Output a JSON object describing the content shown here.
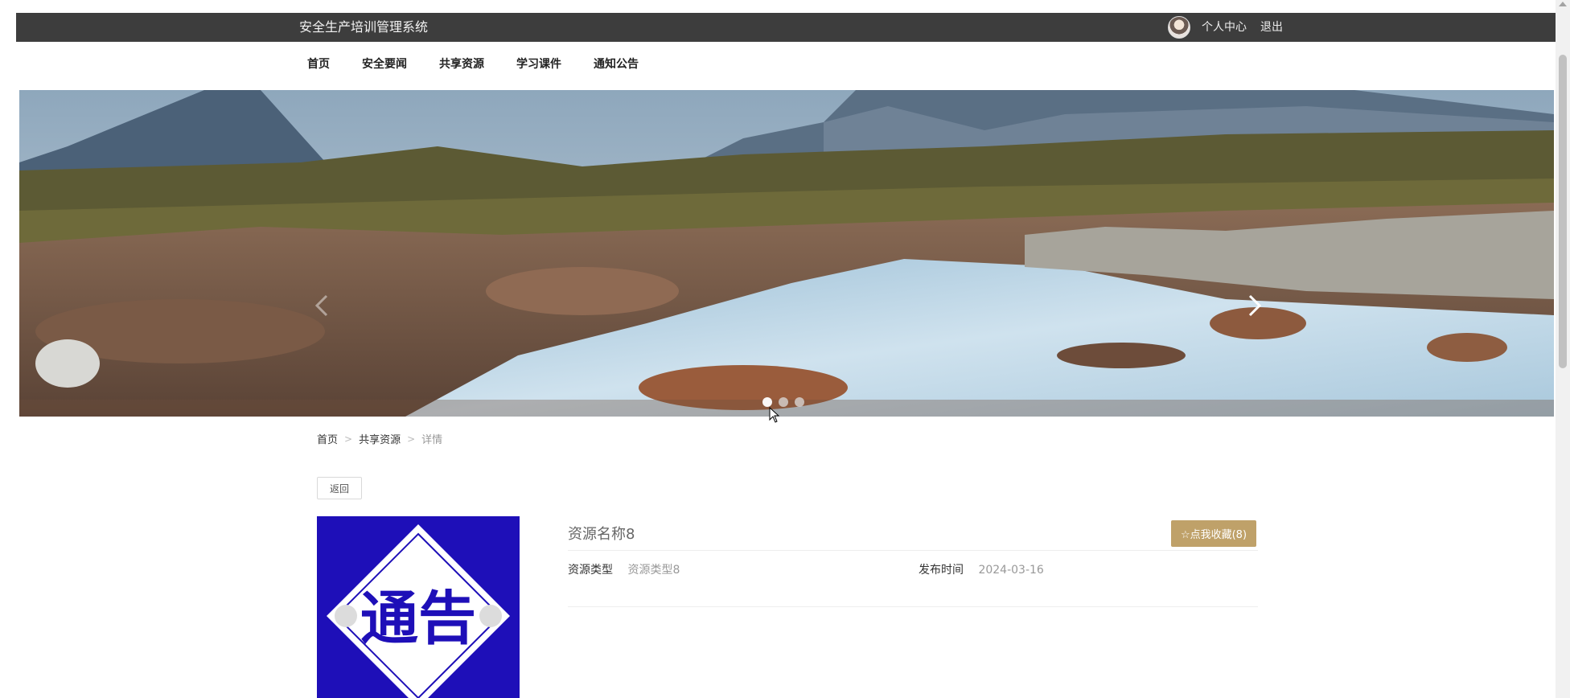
{
  "header": {
    "app_title": "安全生产培训管理系统",
    "personal_center": "个人中心",
    "logout": "退出"
  },
  "nav": {
    "items": [
      "首页",
      "安全要闻",
      "共享资源",
      "学习课件",
      "通知公告"
    ]
  },
  "carousel": {
    "dot_count": 3,
    "active_index": 0
  },
  "breadcrumb": {
    "home": "首页",
    "section": "共享资源",
    "current": "详情",
    "separator": ">"
  },
  "detail": {
    "back_label": "返回",
    "title": "资源名称8",
    "favorite_label": "☆点我收藏(8)",
    "type_label": "资源类型",
    "type_value": "资源类型8",
    "date_label": "发布时间",
    "date_value": "2024-03-16",
    "thumbnail_text": "通告"
  },
  "colors": {
    "topbar_bg": "#3d3d3d",
    "favorite_button": "#bfa169",
    "thumbnail_bg": "#1e0fb8"
  }
}
